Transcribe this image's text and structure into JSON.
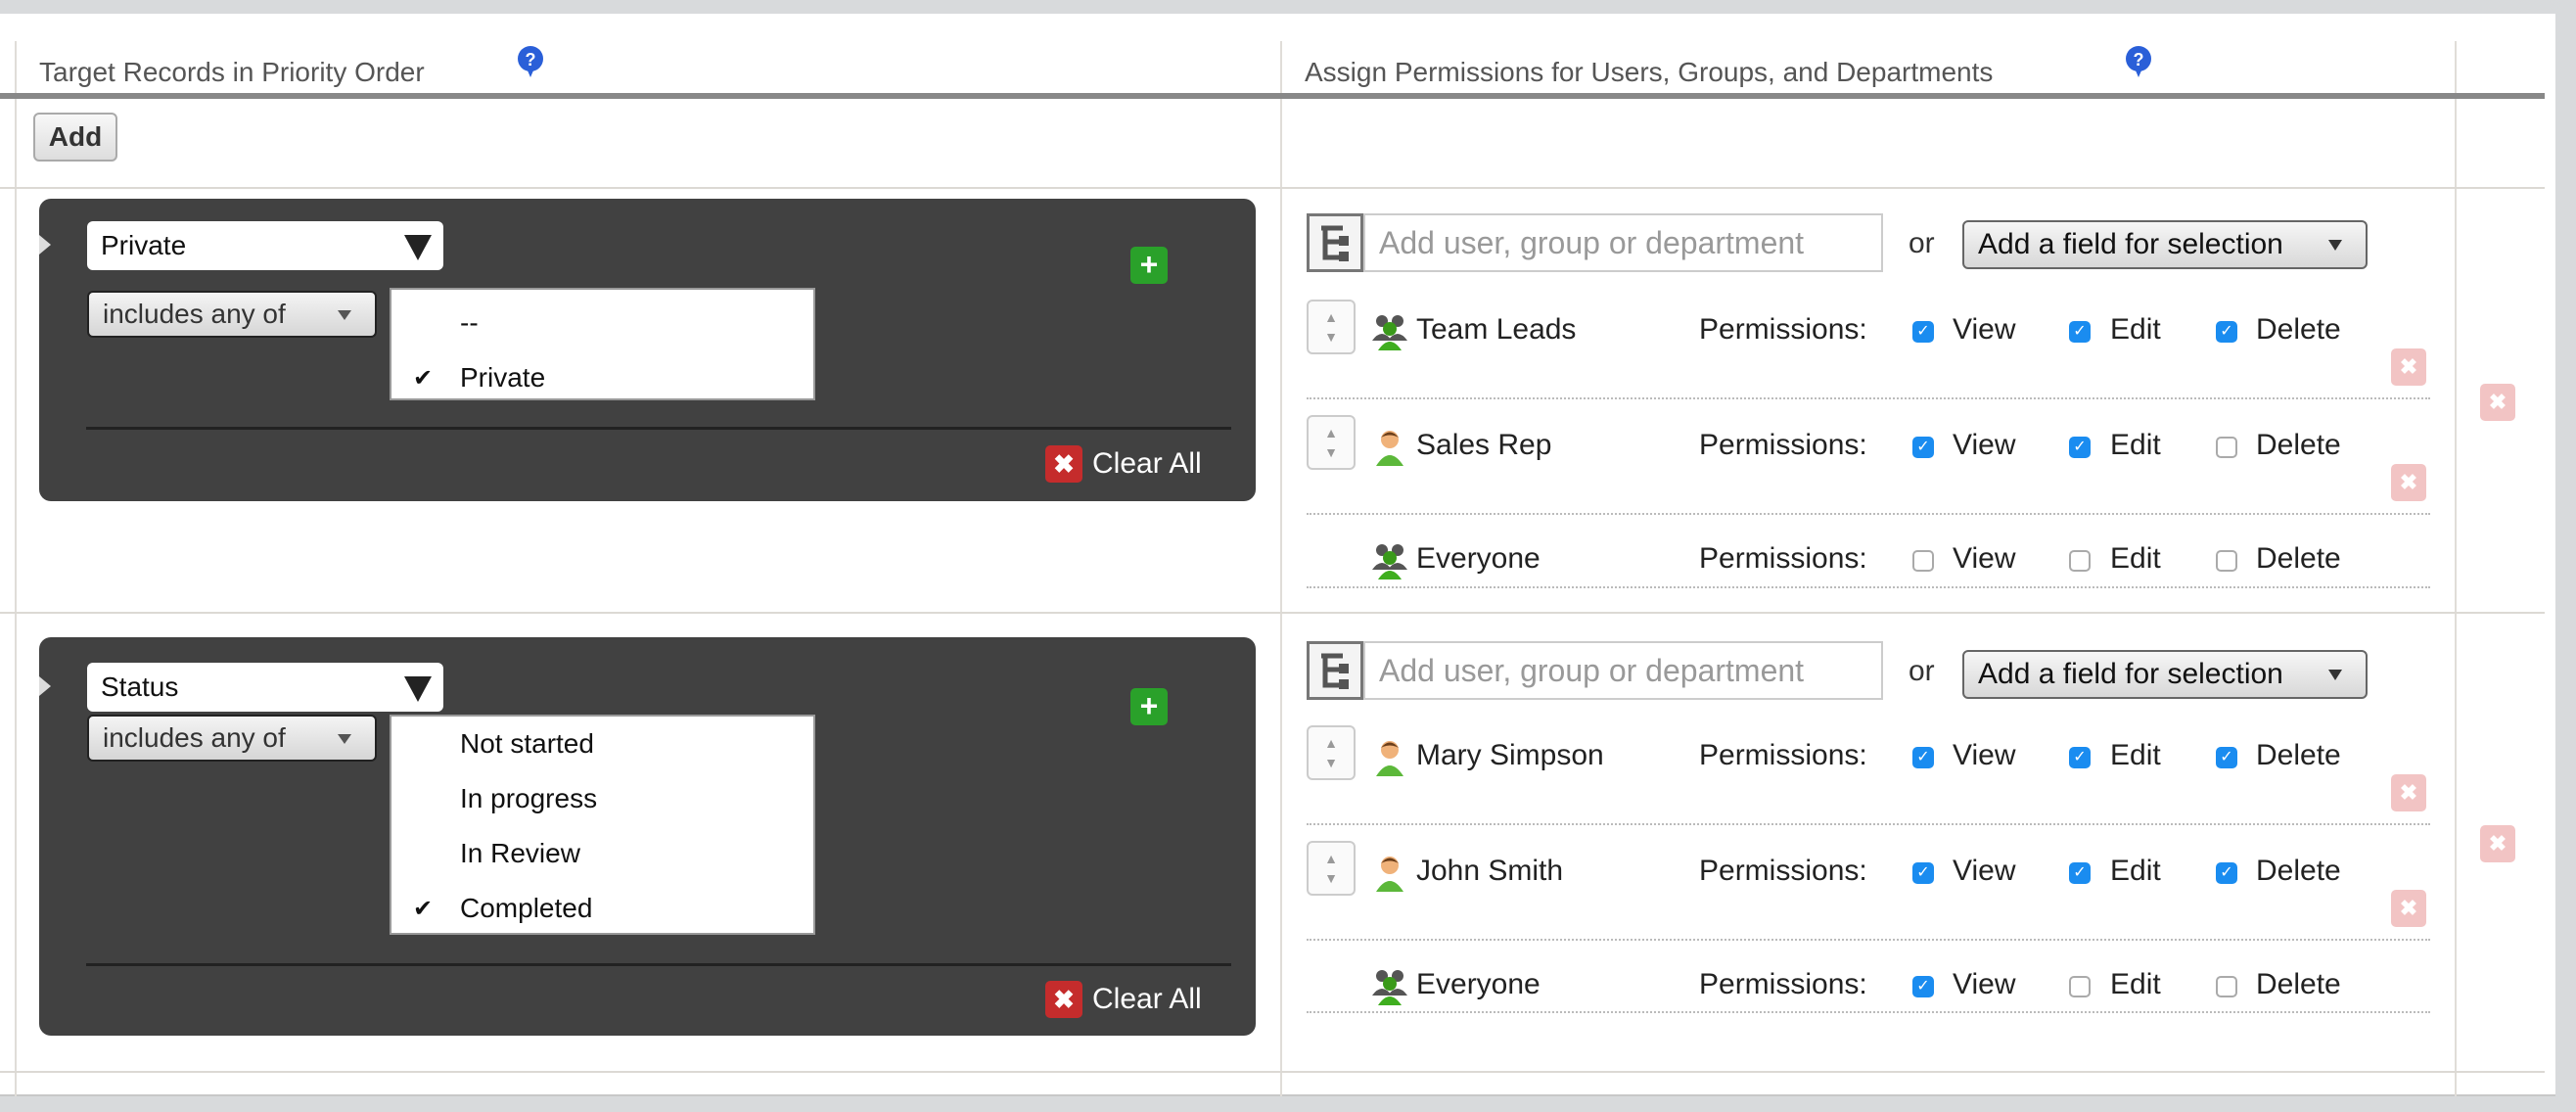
{
  "header": {
    "target_title": "Target Records in Priority Order",
    "assign_title": "Assign Permissions for Users, Groups, and Departments"
  },
  "toolbar": {
    "add_label": "Add"
  },
  "common": {
    "user_placeholder": "Add user, group or department",
    "or": "or",
    "field_select": "Add a field for selection",
    "permissions_label": "Permissions:",
    "view": "View",
    "edit": "Edit",
    "delete": "Delete",
    "clear_all": "Clear All"
  },
  "rules": [
    {
      "field": "Private",
      "operator": "includes any of",
      "options": [
        {
          "label": "--",
          "checked": false
        },
        {
          "label": "Private",
          "checked": true
        }
      ],
      "entities": [
        {
          "name": "Team Leads",
          "type": "group",
          "view": true,
          "edit": true,
          "delete": true,
          "movable": true
        },
        {
          "name": "Sales Rep",
          "type": "user",
          "view": true,
          "edit": true,
          "delete": false,
          "movable": true
        },
        {
          "name": "Everyone",
          "type": "group",
          "view": false,
          "edit": false,
          "delete": false,
          "movable": false
        }
      ]
    },
    {
      "field": "Status",
      "operator": "includes any of",
      "options": [
        {
          "label": "Not started",
          "checked": false
        },
        {
          "label": "In progress",
          "checked": false
        },
        {
          "label": "In Review",
          "checked": false
        },
        {
          "label": "Completed",
          "checked": true
        }
      ],
      "entities": [
        {
          "name": "Mary Simpson",
          "type": "user",
          "view": true,
          "edit": true,
          "delete": true,
          "movable": true
        },
        {
          "name": "John Smith",
          "type": "user",
          "view": true,
          "edit": true,
          "delete": true,
          "movable": true
        },
        {
          "name": "Everyone",
          "type": "group",
          "view": true,
          "edit": false,
          "delete": false,
          "movable": false
        }
      ]
    }
  ]
}
